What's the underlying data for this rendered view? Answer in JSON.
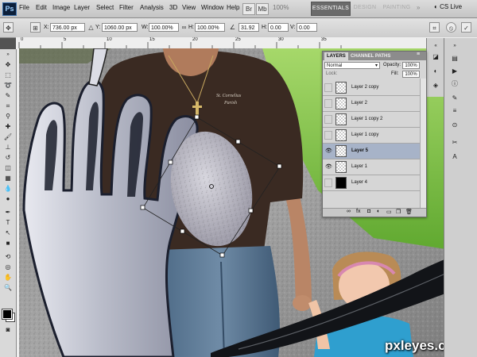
{
  "app": {
    "logo": "Ps",
    "menu": [
      "File",
      "Edit",
      "Image",
      "Layer",
      "Select",
      "Filter",
      "Analysis",
      "3D",
      "View",
      "Window",
      "Help"
    ],
    "menubar_icons": [
      "Br",
      "Mb"
    ],
    "zoom": "100%",
    "workspaces": [
      "ESSENTIALS",
      "DESIGN",
      "PAINTING"
    ],
    "active_workspace": "ESSENTIALS",
    "more": "»",
    "cs_live": "CS Live"
  },
  "options": {
    "x_label": "X:",
    "x_value": "736.00 px",
    "y_label": "Y:",
    "y_value": "1060.00 px",
    "w_label": "W:",
    "w_value": "100.00%",
    "h_label": "H:",
    "h_value": "100.00%",
    "angle_value": "31.92",
    "hskew_label": "H:",
    "hskew_value": "0.00",
    "vskew_label": "V:",
    "vskew_value": "0.00"
  },
  "rulers": {
    "top_ticks": [
      "0",
      "5",
      "10",
      "15",
      "20",
      "25",
      "30",
      "35"
    ]
  },
  "layers_panel": {
    "tabs": [
      "LAYERS",
      "CHANNEL PATHS"
    ],
    "blend_mode": "Normal",
    "opacity_label": "Opacity:",
    "opacity_value": "100%",
    "lock_label": "Lock:",
    "fill_label": "Fill:",
    "fill_value": "100%",
    "layers": [
      {
        "name": "Layer 2 copy",
        "visible": false,
        "selected": false,
        "thumb": "transparent"
      },
      {
        "name": "Layer 2",
        "visible": false,
        "selected": false,
        "thumb": "transparent"
      },
      {
        "name": "Layer 1 copy 2",
        "visible": false,
        "selected": false,
        "thumb": "transparent"
      },
      {
        "name": "Layer 1 copy",
        "visible": false,
        "selected": false,
        "thumb": "transparent"
      },
      {
        "name": "Layer 5",
        "visible": true,
        "selected": true,
        "thumb": "transparent"
      },
      {
        "name": "Layer 1",
        "visible": true,
        "selected": false,
        "thumb": "transparent"
      },
      {
        "name": "Layer 4",
        "visible": false,
        "selected": false,
        "thumb": "black"
      }
    ]
  },
  "canvas": {
    "watermark": "pxleyes.com",
    "shirt_text_line1": "St. Cornelius",
    "shirt_text_line2": "Parish"
  },
  "colors": {
    "accent_selected_layer": "#a7b3c8",
    "foreground": "#000000",
    "background": "#ffffff"
  }
}
